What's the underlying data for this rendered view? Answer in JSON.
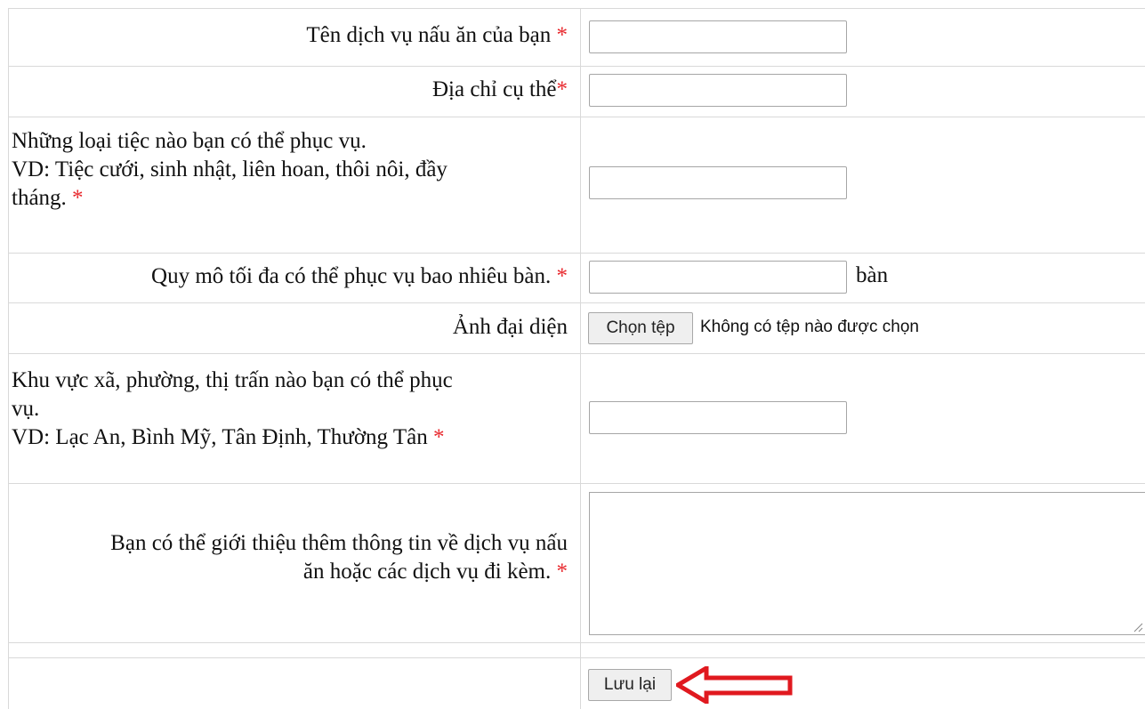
{
  "form": {
    "service_name": {
      "label": "Tên dịch vụ nấu ăn của bạn",
      "required": "*",
      "value": ""
    },
    "address": {
      "label": "Địa chỉ cụ thể",
      "required": "*",
      "value": ""
    },
    "party_types": {
      "label_line1": "Những loại tiệc nào bạn có thể phục vụ.",
      "label_line2": "VD: Tiệc cưới, sinh nhật, liên hoan, thôi nôi, đầy",
      "label_line3": "tháng.",
      "required": "*",
      "value": ""
    },
    "max_scale": {
      "label": "Quy mô tối đa có thể phục vụ bao nhiêu bàn.",
      "required": "*",
      "value": "",
      "suffix": "bàn"
    },
    "avatar": {
      "label": "Ảnh đại diện",
      "choose_button": "Chọn tệp",
      "status": "Không có tệp nào được chọn"
    },
    "areas": {
      "label_line1": "Khu vực xã, phường, thị trấn nào bạn có thể phục",
      "label_line2": "vụ.",
      "label_line3": "VD: Lạc An, Bình Mỹ, Tân Định, Thường Tân",
      "required": "*",
      "value": ""
    },
    "intro": {
      "label_line1": "Bạn có thể giới thiệu thêm thông tin về dịch vụ nấu",
      "label_line2": "ăn hoặc các dịch vụ đi kèm.",
      "required": "*",
      "value": ""
    },
    "save_button": "Lưu lại"
  },
  "colors": {
    "required": "#e8262b",
    "arrow": "#e0191f",
    "border": "#d9d9d9"
  }
}
